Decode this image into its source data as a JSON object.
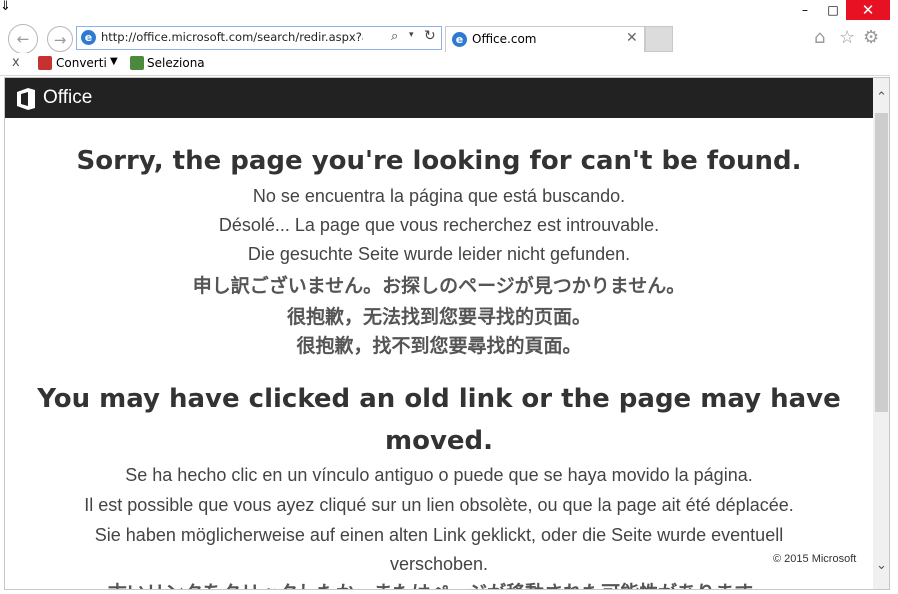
{
  "window": {
    "minimize_glyph": "–",
    "maximize_glyph": "□",
    "close_glyph": "✕"
  },
  "navigation": {
    "back_glyph": "←",
    "forward_glyph": "→",
    "address": "http://office.microsoft.com/search/redir.aspx?assetid=",
    "address_icon": "ie-page-icon",
    "search_glyph": "⌕",
    "dropdown_glyph": "▾",
    "refresh_glyph": "↻"
  },
  "tab": {
    "title": "Office.com",
    "close_glyph": "✕"
  },
  "toolbar_icons": {
    "home": "⌂",
    "favorites": "☆",
    "settings": "⚙"
  },
  "command_bar": {
    "close_glyph": "x",
    "convert_label": "Converti",
    "dropdown_glyph": "▼",
    "select_label": "Seleziona"
  },
  "office_header": {
    "brand": "Office"
  },
  "content": {
    "heading_not_found": "Sorry, the page you're looking for can't be found.",
    "not_found_es": "No se encuentra la página que está buscando.",
    "not_found_fr": "Désolé... La page que vous recherchez est introuvable.",
    "not_found_de": "Die gesuchte Seite wurde leider nicht gefunden.",
    "not_found_ja": "申し訳ございません。お探しのページが見つかりません。",
    "not_found_zh_cn": "很抱歉，无法找到您要寻找的页面。",
    "not_found_zh_tw": "很抱歉，找不到您要尋找的頁面。",
    "heading_old_link_line1": "You may have clicked an old link or the page may have",
    "heading_old_link_line2": "moved.",
    "old_link_es": "Se ha hecho clic en un vínculo antiguo o puede que se haya movido la página.",
    "old_link_fr": "Il est possible que vous ayez cliqué sur un lien obsolète, ou que la page ait été déplacée.",
    "old_link_de_line1": "Sie haben möglicherweise auf einen alten Link geklickt, oder die Seite wurde eventuell",
    "old_link_de_line2": "verschoben.",
    "old_link_ja": "古いリンクをクリックしたか、またはページが移動された可能性があります。",
    "copyright": "© 2015 Microsoft"
  },
  "scrollbar": {
    "up_glyph": "⌃",
    "down_glyph": "⌄"
  }
}
